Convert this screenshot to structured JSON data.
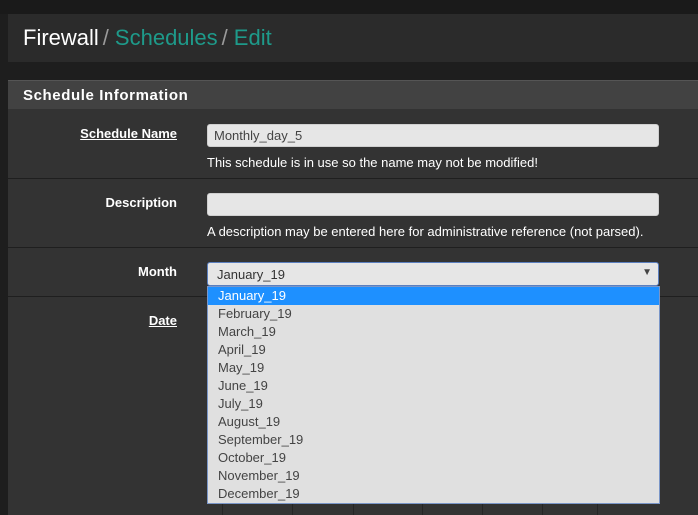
{
  "breadcrumb": {
    "root": "Firewall",
    "separator": "/",
    "schedules": "Schedules",
    "edit": "Edit"
  },
  "panel": {
    "title": "Schedule Information"
  },
  "form": {
    "name": {
      "label": "Schedule Name",
      "value": "Monthly_day_5",
      "help": "This schedule is in use so the name may not be modified!"
    },
    "description": {
      "label": "Description",
      "value": "",
      "help": "A description may be entered here for administrative reference (not parsed)."
    },
    "month": {
      "label": "Month",
      "value": "January_19",
      "options": [
        "January_19",
        "February_19",
        "March_19",
        "April_19",
        "May_19",
        "June_19",
        "July_19",
        "August_19",
        "September_19",
        "October_19",
        "November_19",
        "December_19"
      ],
      "selected_index": 0
    },
    "date": {
      "label": "Date"
    }
  },
  "colors": {
    "accent": "#1e9a8a",
    "selection": "#1e90ff",
    "panel_bg": "#333333",
    "heading_bg": "#424242"
  }
}
